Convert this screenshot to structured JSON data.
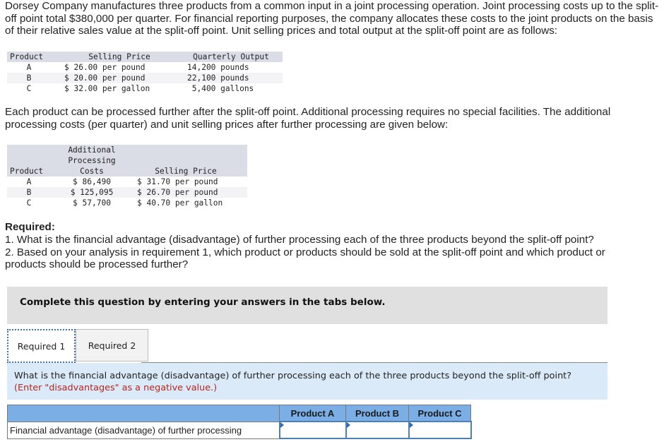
{
  "intro": "Dorsey Company manufactures three products from a common input in a joint processing operation. Joint processing costs up to the split-off point total $380,000 per quarter. For financial reporting purposes, the company allocates these costs to the joint products on the basis of their relative sales value at the split-off point. Unit selling prices and total output at the split-off point are as follows:",
  "table1": {
    "headers": [
      "Product",
      "Selling Price",
      "Quarterly Output"
    ],
    "rows": [
      [
        "A",
        "$ 26.00 per pound",
        "14,200 pounds"
      ],
      [
        "B",
        "$ 20.00 per pound",
        "22,100 pounds"
      ],
      [
        "C",
        "$ 32.00 per gallon",
        " 5,400 gallons"
      ]
    ]
  },
  "para2": "Each product can be processed further after the split-off point. Additional processing requires no special facilities. The additional processing costs (per quarter) and unit selling prices after further processing are given below:",
  "table2": {
    "headers": [
      "Product",
      "Additional\nProcessing\nCosts",
      "Selling Price"
    ],
    "rows": [
      [
        "A",
        "$ 86,490",
        "$ 31.70 per pound"
      ],
      [
        "B",
        "$ 125,095",
        "$ 26.70 per pound"
      ],
      [
        "C",
        "$ 57,700",
        "$ 40.70 per gallon"
      ]
    ]
  },
  "required": {
    "heading": "Required:",
    "items": [
      "1. What is the financial advantage (disadvantage) of further processing each of the three products beyond the split-off point?",
      "2. Based on your analysis in requirement 1, which product or products should be sold at the split-off point and which product or products should be processed further?"
    ]
  },
  "instruction": "Complete this question by entering your answers in the tabs below.",
  "tabs": [
    {
      "label": "Required 1",
      "active": true
    },
    {
      "label": "Required 2",
      "active": false
    }
  ],
  "question": {
    "text": "What is the financial advantage (disadvantage) of further processing each of the three products beyond the split-off point?",
    "note": "(Enter \"disadvantages\" as a negative value.)",
    "note_color": "#b3261e"
  },
  "answer_table": {
    "headers": [
      "",
      "Product A",
      "Product B",
      "Product C"
    ],
    "row_label": "Financial advantage (disadvantage) of further processing",
    "values": [
      "",
      "",
      ""
    ]
  },
  "colors": {
    "header_blue": "#7aaee4",
    "question_bg": "#dbeaf8",
    "instruction_bg": "#e0e0e0"
  }
}
